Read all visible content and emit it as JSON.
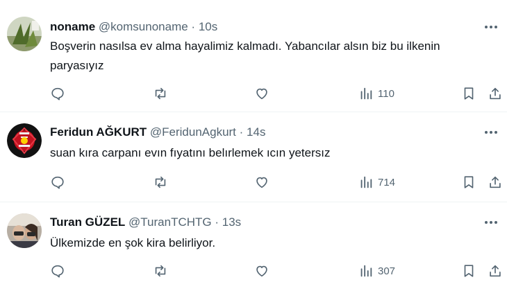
{
  "tweets": [
    {
      "name": "noname",
      "handle": "@komsunoname",
      "separator": "·",
      "time": "10s",
      "text": "Boşverin nasılsa ev alma hayalimiz kalmadı. Yabancılar alsın biz bu ilkenin paryasıyız",
      "views": "110",
      "avatar_icon": "plant-photo-avatar"
    },
    {
      "name": "Feridun AĞKURT",
      "handle": "@FeridunAgkurt",
      "separator": "·",
      "time": "14s",
      "text": "suan kıra carpanı evın fıyatını belırlemek ıcın yetersız",
      "views": "714",
      "avatar_icon": "red-emblem-avatar"
    },
    {
      "name": "Turan GÜZEL",
      "handle": "@TuranTCHTG",
      "separator": "·",
      "time": "13s",
      "text": "Ülkemizde en şok kira belirliyor.",
      "views": "307",
      "avatar_icon": "couple-photo-avatar"
    }
  ],
  "icons": [
    "reply-icon",
    "retweet-icon",
    "like-icon",
    "views-icon",
    "bookmark-icon",
    "share-icon",
    "more-icon"
  ],
  "colors": {
    "text": "#0f1419",
    "secondary": "#536471",
    "divider": "#eff3f4"
  }
}
